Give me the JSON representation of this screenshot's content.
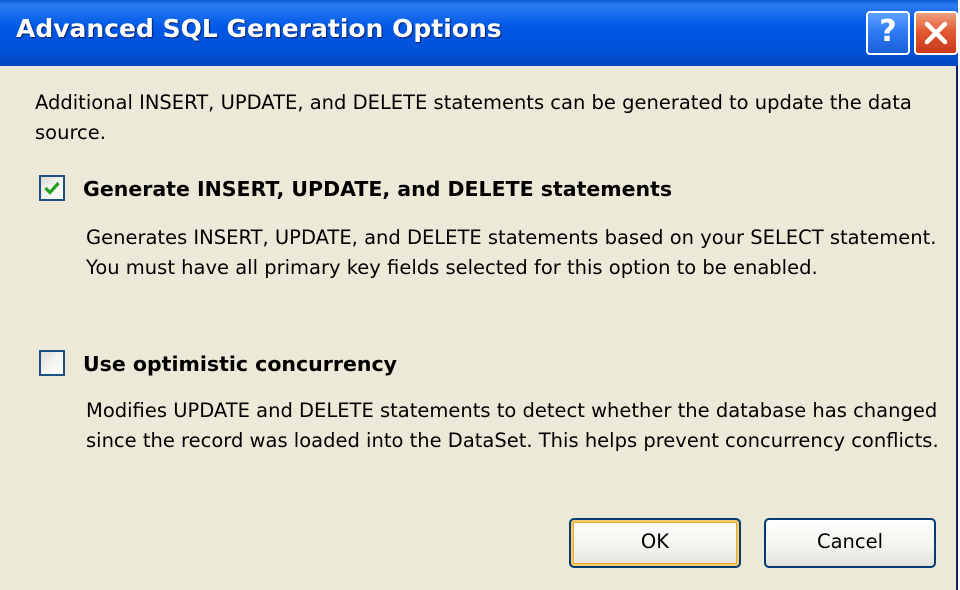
{
  "dialog": {
    "title": "Advanced SQL Generation Options",
    "help_glyph": "?",
    "intro": "Additional INSERT, UPDATE, and DELETE statements can be generated to update the data source."
  },
  "options": [
    {
      "label": "Generate INSERT, UPDATE, and DELETE statements",
      "checked": true,
      "description": "Generates INSERT, UPDATE, and DELETE statements based on your SELECT statement. You must have all primary key fields selected for this option to be enabled."
    },
    {
      "label": "Use optimistic concurrency",
      "checked": false,
      "description": "Modifies UPDATE and DELETE statements to detect whether the database has changed since the record was loaded into the DataSet. This helps prevent concurrency conflicts."
    }
  ],
  "buttons": {
    "ok": "OK",
    "cancel": "Cancel"
  },
  "colors": {
    "titlebar": "#0058e6",
    "dialog_bg": "#ece9d8",
    "check_mark": "#21a121",
    "close_button": "#e25a32"
  },
  "icons": {
    "help": "help-icon",
    "close": "close-icon",
    "check": "check-icon"
  }
}
